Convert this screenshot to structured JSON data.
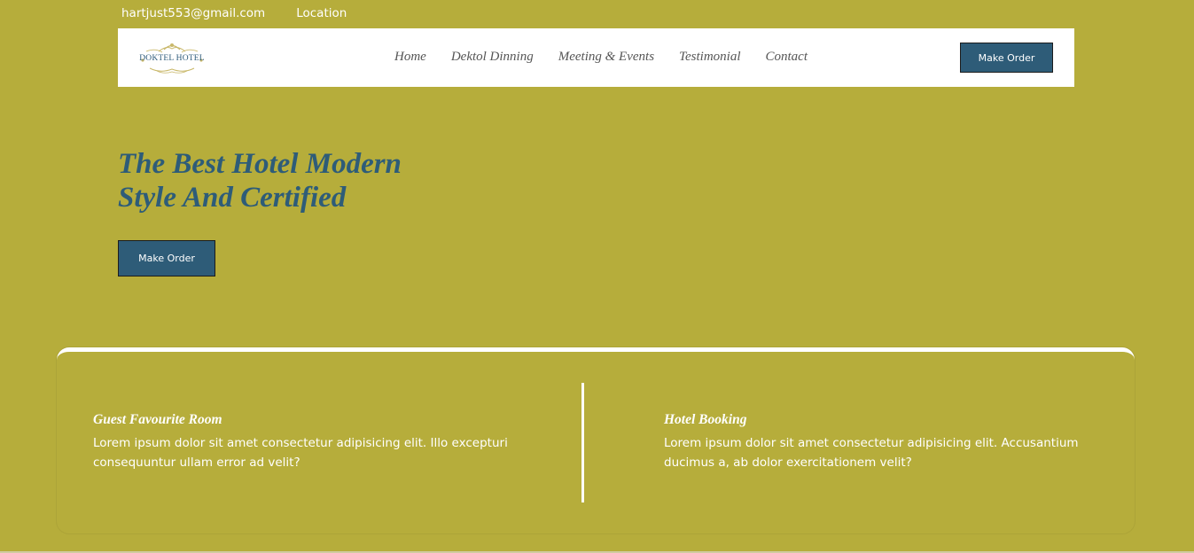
{
  "topbar": {
    "email": "hartjust553@gmail.com",
    "location": "Location"
  },
  "navbar": {
    "logo_text": "DOKTEL HOTEL",
    "links": [
      "Home",
      "Dektol Dinning",
      "Meeting & Events",
      "Testimonial",
      "Contact"
    ],
    "order_button": "Make Order"
  },
  "hero": {
    "title_line1": "The Best Hotel Modern",
    "title_line2": "Style And Certified",
    "order_button": "Make Order"
  },
  "features": [
    {
      "title": "Guest Favourite Room",
      "text": "Lorem ipsum dolor sit amet consectetur adipisicing elit. Illo excepturi consequuntur ullam error ad velit?"
    },
    {
      "title": "Hotel Booking",
      "text": "Lorem ipsum dolor sit amet consectetur adipisicing elit. Accusantium ducimus a, ab dolor exercitationem velit?"
    }
  ],
  "colors": {
    "background": "#b6ad3b",
    "accent": "#2e5c78",
    "white": "#ffffff"
  }
}
